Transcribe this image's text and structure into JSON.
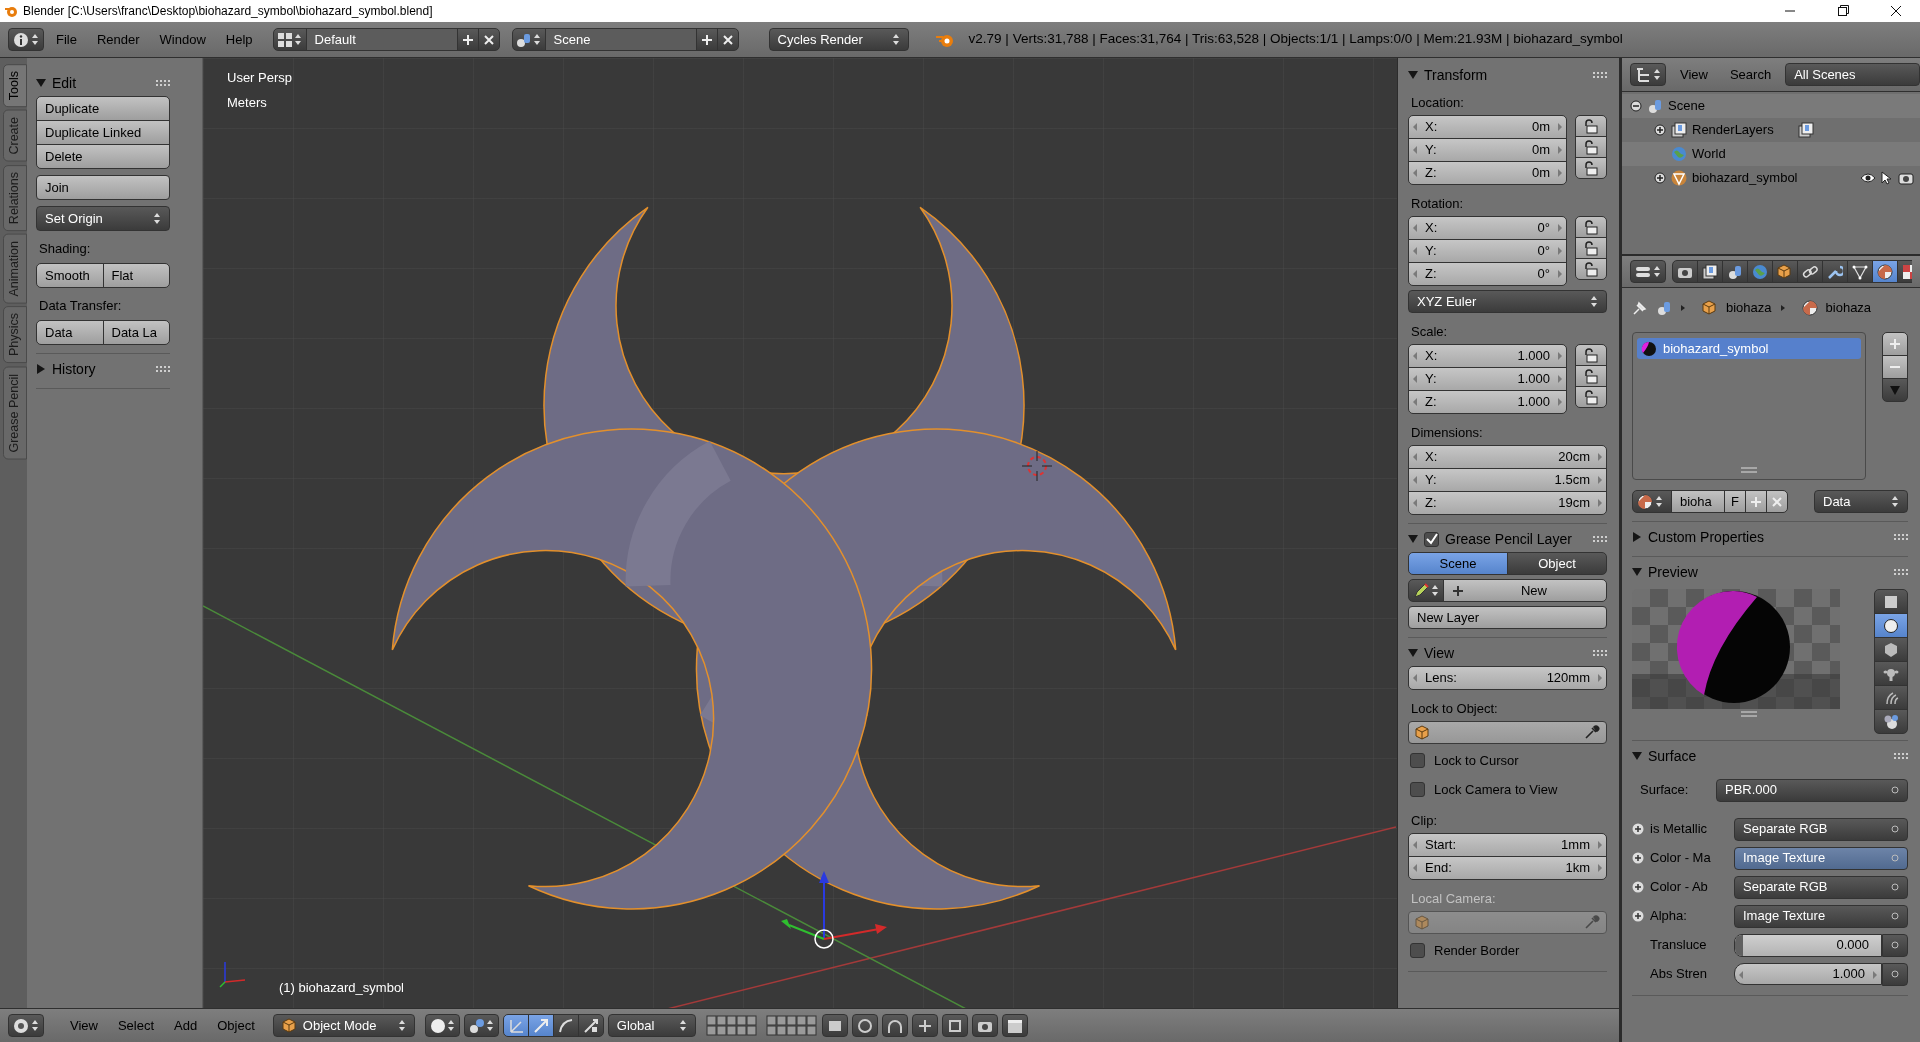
{
  "title_bar": {
    "title": "Blender [C:\\Users\\franc\\Desktop\\biohazard_symbol\\biohazard_symbol.blend]"
  },
  "info_header": {
    "menus": [
      "File",
      "Render",
      "Window",
      "Help"
    ],
    "screen_layout": "Default",
    "scene": "Scene",
    "render_engine": "Cycles Render",
    "stats": "v2.79 | Verts:31,788 | Faces:31,764 | Tris:63,528 | Objects:1/1 | Lamps:0/0 | Mem:21.93M | biohazard_symbol"
  },
  "tool_tabs": [
    {
      "label": "Tools",
      "selected": true
    },
    {
      "label": "Create",
      "selected": false
    },
    {
      "label": "Relations",
      "selected": false
    },
    {
      "label": "Animation",
      "selected": false
    },
    {
      "label": "Physics",
      "selected": false
    },
    {
      "label": "Grease Pencil",
      "selected": false
    }
  ],
  "tool_shelf": {
    "panels": [
      {
        "title": "Edit",
        "expanded": true,
        "items": [
          {
            "kind": "button_column",
            "buttons": [
              "Duplicate",
              "Duplicate Linked",
              "Delete"
            ]
          },
          {
            "kind": "button",
            "label": "Join"
          },
          {
            "kind": "dropdown",
            "label": "Set Origin"
          },
          {
            "kind": "label",
            "text": "Shading:",
            "disabled": false
          },
          {
            "kind": "button_row",
            "buttons": [
              "Smooth",
              "Flat"
            ]
          },
          {
            "kind": "label",
            "text": "Data Transfer:",
            "disabled": false
          },
          {
            "kind": "button_row",
            "buttons": [
              "Data",
              "Data La"
            ]
          }
        ]
      },
      {
        "title": "History",
        "expanded": false
      }
    ]
  },
  "viewport": {
    "view_name": "User Persp",
    "units": "Meters",
    "object_label": "(1) biohazard_symbol"
  },
  "properties_region": {
    "panels": [
      {
        "title": "Transform",
        "expanded": true,
        "items": [
          {
            "kind": "label",
            "text": "Location:",
            "disabled": false
          },
          {
            "kind": "fields",
            "fields": [
              {
                "label": "X:",
                "value": "0m",
                "locked": false
              },
              {
                "label": "Y:",
                "value": "0m",
                "locked": false
              },
              {
                "label": "Z:",
                "value": "0m",
                "locked": false
              }
            ]
          },
          {
            "kind": "label",
            "text": "Rotation:",
            "disabled": false
          },
          {
            "kind": "fields",
            "fields": [
              {
                "label": "X:",
                "value": "0°",
                "locked": false
              },
              {
                "label": "Y:",
                "value": "0°",
                "locked": false
              },
              {
                "label": "Z:",
                "value": "0°",
                "locked": false
              }
            ]
          },
          {
            "kind": "dropdown",
            "label": "XYZ Euler"
          },
          {
            "kind": "label",
            "text": "Scale:",
            "disabled": false
          },
          {
            "kind": "fields",
            "fields": [
              {
                "label": "X:",
                "value": "1.000",
                "locked": false
              },
              {
                "label": "Y:",
                "value": "1.000",
                "locked": false
              },
              {
                "label": "Z:",
                "value": "1.000",
                "locked": false
              }
            ]
          },
          {
            "kind": "label",
            "text": "Dimensions:",
            "disabled": false
          },
          {
            "kind": "fields",
            "fields": [
              {
                "label": "X:",
                "value": "20cm"
              },
              {
                "label": "Y:",
                "value": "1.5cm"
              },
              {
                "label": "Z:",
                "value": "19cm"
              }
            ]
          }
        ]
      },
      {
        "title": "Grease Pencil Layer",
        "expanded": true,
        "checked": true,
        "items": [
          {
            "kind": "toggle_row",
            "options": [
              {
                "label": "Scene",
                "selected": true
              },
              {
                "label": "Object",
                "selected": false
              }
            ]
          },
          {
            "kind": "new_data",
            "label": "New"
          },
          {
            "kind": "button",
            "label": "New Layer"
          }
        ]
      },
      {
        "title": "View",
        "expanded": true,
        "items": [
          {
            "kind": "fields",
            "fields": [
              {
                "label": "Lens:",
                "value": "120mm"
              }
            ]
          },
          {
            "kind": "label",
            "text": "Lock to Object:",
            "disabled": false
          },
          {
            "kind": "object_picker",
            "disabled": false
          },
          {
            "kind": "checkbox",
            "label": "Lock to Cursor",
            "checked": false
          },
          {
            "kind": "checkbox",
            "label": "Lock Camera to View",
            "checked": false
          },
          {
            "kind": "label",
            "text": "Clip:",
            "disabled": false
          },
          {
            "kind": "fields",
            "fields": [
              {
                "label": "Start:",
                "value": "1mm"
              },
              {
                "label": "End:",
                "value": "1km"
              }
            ]
          },
          {
            "kind": "label",
            "text": "Local Camera:",
            "disabled": true
          },
          {
            "kind": "object_picker",
            "disabled": true
          },
          {
            "kind": "checkbox",
            "label": "Render Border",
            "checked": false
          }
        ]
      }
    ]
  },
  "outliner": {
    "menus": [
      "View",
      "Search"
    ],
    "filter": "All Scenes",
    "tree": [
      {
        "kind": "scene",
        "label": "Scene",
        "expanded": true,
        "children": [
          {
            "kind": "render_layers",
            "label": "RenderLayers",
            "expanded": false
          },
          {
            "kind": "world",
            "label": "World"
          },
          {
            "kind": "object",
            "label": "biohazard_symbol",
            "expanded": false
          }
        ]
      }
    ]
  },
  "properties_editor": {
    "tabs": [
      {
        "selected": false
      },
      {
        "selected": false
      },
      {
        "selected": false
      },
      {
        "selected": false
      },
      {
        "selected": false
      },
      {
        "selected": false
      },
      {
        "selected": false
      },
      {
        "selected": false
      },
      {
        "selected": true
      },
      {
        "selected": false
      }
    ],
    "breadcrumb": [
      "biohaza",
      "biohaza"
    ],
    "material_slots": [
      {
        "name": "biohazard_symbol",
        "selected": true
      }
    ],
    "material_selector": {
      "name": "bioha",
      "fake_user": "F",
      "link": "Data"
    },
    "panels": [
      {
        "title": "Custom Properties",
        "expanded": false
      },
      {
        "kind": "preview",
        "title": "Preview",
        "expanded": true,
        "shapes": [
          {
            "selected": false
          },
          {
            "selected": true
          },
          {
            "selected": false
          },
          {
            "selected": false
          },
          {
            "selected": false
          },
          {
            "selected": false
          }
        ]
      },
      {
        "kind": "surface",
        "title": "Surface",
        "expanded": true,
        "surface": {
          "label": "Surface:",
          "value": "PBR.000"
        },
        "inputs": [
          {
            "kind": "link",
            "label": "is Metallic",
            "value": "Separate RGB",
            "highlighted": false
          },
          {
            "kind": "link",
            "label": "Color - Ma",
            "value": "Image Texture",
            "highlighted": true
          },
          {
            "kind": "link",
            "label": "Color - Ab",
            "value": "Separate RGB",
            "highlighted": false
          },
          {
            "kind": "link",
            "label": "Alpha:",
            "value": "Image Texture",
            "highlighted": false
          },
          {
            "kind": "slider",
            "label": "Transluce",
            "value": "0.000",
            "level": 0,
            "highlighted": false
          },
          {
            "kind": "number",
            "label": "Abs Stren",
            "value": "1.000",
            "highlighted": false
          }
        ]
      }
    ]
  },
  "bottom_header": {
    "menus": [
      "View",
      "Select",
      "Add",
      "Object"
    ],
    "mode": "Object Mode",
    "orientation": "Global",
    "manipulators": [
      {
        "selected": true
      },
      {
        "selected": true
      },
      {
        "selected": false
      },
      {
        "selected": false
      }
    ]
  }
}
